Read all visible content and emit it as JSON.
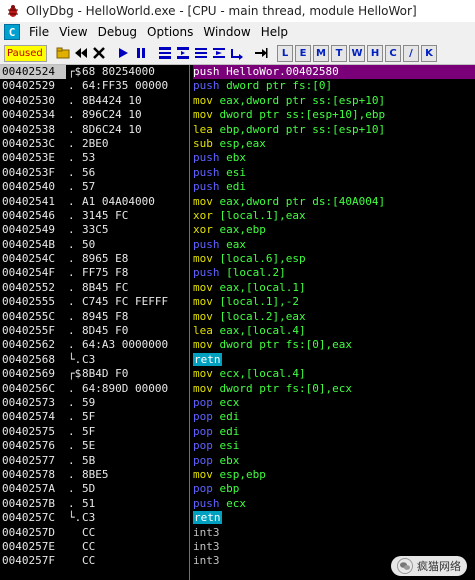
{
  "window": {
    "title": "OllyDbg - HelloWorld.exe - [CPU - main thread, module HelloWor]"
  },
  "menu": [
    "File",
    "View",
    "Debug",
    "Options",
    "Window",
    "Help"
  ],
  "toolbar": {
    "status": "Paused",
    "letters": [
      "L",
      "E",
      "M",
      "T",
      "W",
      "H",
      "C",
      "/",
      "K"
    ]
  },
  "rows": [
    {
      "addr": "00402524",
      "mark": "┌$",
      "hex": "68 80254000",
      "mn": "push",
      "ops": "HelloWor.00402580",
      "cls": "kw-push",
      "sel": true
    },
    {
      "addr": "00402529",
      "mark": ".",
      "hex": "64:FF35 00000",
      "mn": "push",
      "ops": "dword ptr fs:[0]",
      "cls": "kw-push"
    },
    {
      "addr": "00402530",
      "mark": ".",
      "hex": "8B4424 10",
      "mn": "mov",
      "ops": "eax,dword ptr ss:[esp+10]",
      "cls": "kw-mov"
    },
    {
      "addr": "00402534",
      "mark": ".",
      "hex": "896C24 10",
      "mn": "mov",
      "ops": "dword ptr ss:[esp+10],ebp",
      "cls": "kw-mov"
    },
    {
      "addr": "00402538",
      "mark": ".",
      "hex": "8D6C24 10",
      "mn": "lea",
      "ops": "ebp,dword ptr ss:[esp+10]",
      "cls": "kw-lea"
    },
    {
      "addr": "0040253C",
      "mark": ".",
      "hex": "2BE0",
      "mn": "sub",
      "ops": "esp,eax",
      "cls": "kw-sub"
    },
    {
      "addr": "0040253E",
      "mark": ".",
      "hex": "53",
      "mn": "push",
      "ops": "ebx",
      "cls": "kw-push"
    },
    {
      "addr": "0040253F",
      "mark": ".",
      "hex": "56",
      "mn": "push",
      "ops": "esi",
      "cls": "kw-push"
    },
    {
      "addr": "00402540",
      "mark": ".",
      "hex": "57",
      "mn": "push",
      "ops": "edi",
      "cls": "kw-push"
    },
    {
      "addr": "00402541",
      "mark": ".",
      "hex": "A1 04A04000",
      "mn": "mov",
      "ops": "eax,dword ptr ds:[40A004]",
      "cls": "kw-mov"
    },
    {
      "addr": "00402546",
      "mark": ".",
      "hex": "3145 FC",
      "mn": "xor",
      "ops": "[local.1],eax",
      "cls": "kw-xor"
    },
    {
      "addr": "00402549",
      "mark": ".",
      "hex": "33C5",
      "mn": "xor",
      "ops": "eax,ebp",
      "cls": "kw-xor"
    },
    {
      "addr": "0040254B",
      "mark": ".",
      "hex": "50",
      "mn": "push",
      "ops": "eax",
      "cls": "kw-push"
    },
    {
      "addr": "0040254C",
      "mark": ".",
      "hex": "8965 E8",
      "mn": "mov",
      "ops": "[local.6],esp",
      "cls": "kw-mov"
    },
    {
      "addr": "0040254F",
      "mark": ".",
      "hex": "FF75 F8",
      "mn": "push",
      "ops": "[local.2]",
      "cls": "kw-push"
    },
    {
      "addr": "00402552",
      "mark": ".",
      "hex": "8B45 FC",
      "mn": "mov",
      "ops": "eax,[local.1]",
      "cls": "kw-mov"
    },
    {
      "addr": "00402555",
      "mark": ".",
      "hex": "C745 FC FEFFF",
      "mn": "mov",
      "ops": "[local.1],-2",
      "cls": "kw-mov"
    },
    {
      "addr": "0040255C",
      "mark": ".",
      "hex": "8945 F8",
      "mn": "mov",
      "ops": "[local.2],eax",
      "cls": "kw-mov"
    },
    {
      "addr": "0040255F",
      "mark": ".",
      "hex": "8D45 F0",
      "mn": "lea",
      "ops": "eax,[local.4]",
      "cls": "kw-lea"
    },
    {
      "addr": "00402562",
      "mark": ".",
      "hex": "64:A3 0000000",
      "mn": "mov",
      "ops": "dword ptr fs:[0],eax",
      "cls": "kw-mov"
    },
    {
      "addr": "00402568",
      "mark": "└.",
      "hex": "C3",
      "mn": "retn",
      "ops": "",
      "cls": "kw-retn"
    },
    {
      "addr": "00402569",
      "mark": "┌$",
      "hex": "8B4D F0",
      "mn": "mov",
      "ops": "ecx,[local.4]",
      "cls": "kw-mov"
    },
    {
      "addr": "0040256C",
      "mark": ".",
      "hex": "64:890D 00000",
      "mn": "mov",
      "ops": "dword ptr fs:[0],ecx",
      "cls": "kw-mov"
    },
    {
      "addr": "00402573",
      "mark": ".",
      "hex": "59",
      "mn": "pop",
      "ops": "ecx",
      "cls": "kw-pop"
    },
    {
      "addr": "00402574",
      "mark": ".",
      "hex": "5F",
      "mn": "pop",
      "ops": "edi",
      "cls": "kw-pop"
    },
    {
      "addr": "00402575",
      "mark": ".",
      "hex": "5F",
      "mn": "pop",
      "ops": "edi",
      "cls": "kw-pop"
    },
    {
      "addr": "00402576",
      "mark": ".",
      "hex": "5E",
      "mn": "pop",
      "ops": "esi",
      "cls": "kw-pop"
    },
    {
      "addr": "00402577",
      "mark": ".",
      "hex": "5B",
      "mn": "pop",
      "ops": "ebx",
      "cls": "kw-pop"
    },
    {
      "addr": "00402578",
      "mark": ".",
      "hex": "8BE5",
      "mn": "mov",
      "ops": "esp,ebp",
      "cls": "kw-mov"
    },
    {
      "addr": "0040257A",
      "mark": ".",
      "hex": "5D",
      "mn": "pop",
      "ops": "ebp",
      "cls": "kw-pop"
    },
    {
      "addr": "0040257B",
      "mark": ".",
      "hex": "51",
      "mn": "push",
      "ops": "ecx",
      "cls": "kw-push"
    },
    {
      "addr": "0040257C",
      "mark": "└.",
      "hex": "C3",
      "mn": "retn",
      "ops": "",
      "cls": "kw-retn"
    },
    {
      "addr": "0040257D",
      "mark": "",
      "hex": "CC",
      "mn": "int3",
      "ops": "",
      "cls": "kw-int"
    },
    {
      "addr": "0040257E",
      "mark": "",
      "hex": "CC",
      "mn": "int3",
      "ops": "",
      "cls": "kw-int"
    },
    {
      "addr": "0040257F",
      "mark": "",
      "hex": "CC",
      "mn": "int3",
      "ops": "",
      "cls": "kw-int"
    }
  ],
  "watermark": "疯猫网络"
}
